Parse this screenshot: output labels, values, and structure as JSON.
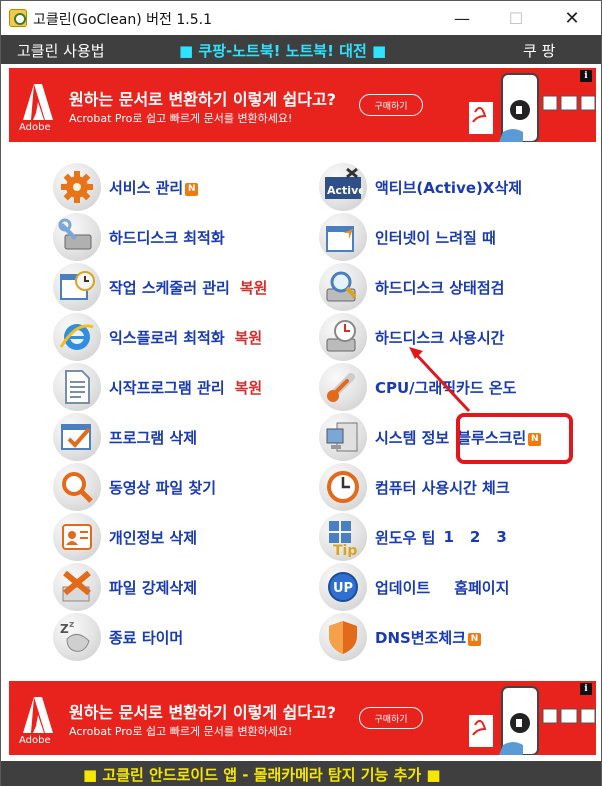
{
  "window": {
    "title": "고클린(GoClean) 버전 1.5.1",
    "minimize": "—",
    "maximize": "☐",
    "close": "✕"
  },
  "menubar": {
    "left": "고클린 사용법",
    "center": "■ 쿠팡-노트북! 노트북! 대전 ■",
    "right": "쿠 팡"
  },
  "ad": {
    "logo_text": "Adobe",
    "headline": "원하는 문서로 변환하기 이렇게 쉽다고?",
    "sub": "Acrobat Pro로 쉽고 빠르게 문서를 변환하세요!",
    "button": "구매하기",
    "info": "i",
    "accent": "#e8231e"
  },
  "badge": "N",
  "tools_left": [
    {
      "label": "서비스 관리",
      "icon": "gear-icon",
      "badge": true,
      "extra": ""
    },
    {
      "label": "하드디스크 최적화",
      "icon": "wrench-disk-icon",
      "badge": false,
      "extra": ""
    },
    {
      "label": "작업 스케줄러 관리",
      "icon": "scheduler-icon",
      "badge": false,
      "extra": "복원"
    },
    {
      "label": "익스플로러 최적화",
      "icon": "ie-icon",
      "badge": false,
      "extra": "복원"
    },
    {
      "label": "시작프로그램 관리",
      "icon": "document-icon",
      "badge": false,
      "extra": "복원"
    },
    {
      "label": "프로그램 삭제",
      "icon": "uninstall-icon",
      "badge": false,
      "extra": ""
    },
    {
      "label": "동영상 파일 찾기",
      "icon": "magnifier-icon",
      "badge": false,
      "extra": ""
    },
    {
      "label": "개인정보 삭제",
      "icon": "privacy-icon",
      "badge": false,
      "extra": ""
    },
    {
      "label": "파일 강제삭제",
      "icon": "delete-file-icon",
      "badge": false,
      "extra": ""
    },
    {
      "label": "종료 타이머",
      "icon": "sleep-timer-icon",
      "badge": false,
      "extra": ""
    }
  ],
  "tools_right": [
    {
      "label": "액티브(Active)X삭제",
      "icon": "activex-icon",
      "badge": false,
      "extra": ""
    },
    {
      "label": "인터넷이 느려질 때",
      "icon": "internet-speed-icon",
      "badge": false,
      "extra": ""
    },
    {
      "label": "하드디스크 상태점검",
      "icon": "disk-check-icon",
      "badge": false,
      "extra": ""
    },
    {
      "label": "하드디스크 사용시간",
      "icon": "disk-time-icon",
      "badge": false,
      "extra": ""
    },
    {
      "label": "CPU/그래픽카드 온도",
      "icon": "thermometer-icon",
      "badge": false,
      "extra": ""
    },
    {
      "label": "시스템 정보",
      "icon": "computer-icon",
      "badge": false,
      "extra": "블루스크린",
      "extra_badge": true
    },
    {
      "label": "컴퓨터 사용시간 체크",
      "icon": "clock-icon",
      "badge": false,
      "extra": ""
    },
    {
      "label": "윈도우 팁",
      "icon": "windows-tip-icon",
      "badge": false,
      "tips": [
        "1",
        "2",
        "3"
      ]
    },
    {
      "label": "업데이트",
      "icon": "update-icon",
      "badge": false,
      "extra": "홈페이지"
    },
    {
      "label": "DNS변조체크",
      "icon": "shield-icon",
      "badge": true,
      "extra": ""
    }
  ],
  "status": "■ 고클린 안드로이드 앱 - 몰래카메라 탐지 기능 추가 ■",
  "colors": {
    "label": "#1a3bb0",
    "restore": "#d03030",
    "menu_center": "#2ee3ff",
    "status": "#f5e700",
    "callout": "#e3161b"
  }
}
